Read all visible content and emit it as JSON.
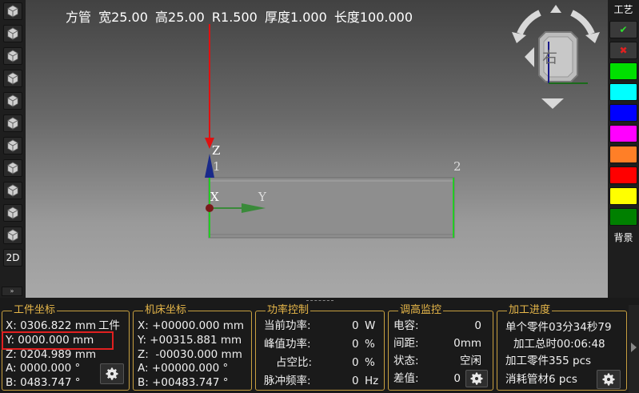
{
  "tube_info": {
    "shape": "方管",
    "width": "宽25.00",
    "height": "高25.00",
    "radius": "R1.500",
    "thickness": "厚度1.000",
    "length": "长度100.000"
  },
  "view_cube": {
    "face_label": "右"
  },
  "axes": {
    "z": "Z",
    "x": "X",
    "y": "Y",
    "point1": "1",
    "point2": "2"
  },
  "left_toolbar": {
    "buttons": [
      "view-iso-1",
      "view-front",
      "view-back",
      "view-left",
      "view-right",
      "view-top",
      "view-bottom",
      "view-iso-2",
      "view-iso-3",
      "view-iso-4",
      "view-iso-5"
    ],
    "label_2d": "2D",
    "collapse": "»"
  },
  "right_bar": {
    "process_label": "工艺",
    "confirm": "✔",
    "cancel": "✖",
    "layer_colors": [
      "#00e000",
      "#00ffff",
      "#0000ff",
      "#ff00ff",
      "#ff7f27",
      "#ff0000",
      "#ffff00",
      "#008000"
    ],
    "background_label": "背景"
  },
  "workpiece": {
    "title": "工件坐标",
    "x": "X: 0306.822 mm",
    "x_tag": "工件",
    "y": "Y: 0000.000 mm",
    "z": "Z: 0204.989 mm",
    "a": "A: 0000.000 °",
    "b": "B: 0483.747 °"
  },
  "machine": {
    "title": "机床坐标",
    "x": "X: +00000.000 mm",
    "y": "Y: +00315.881 mm",
    "z": "Z:  -00030.000 mm",
    "a": "A: +00000.000 °",
    "b": "B: +00483.747 °"
  },
  "power": {
    "title": "功率控制",
    "rows": [
      {
        "label": "当前功率:",
        "value": "0",
        "unit": "W"
      },
      {
        "label": "峰值功率:",
        "value": "0",
        "unit": "%"
      },
      {
        "label": "占空比:",
        "value": "0",
        "unit": "%"
      },
      {
        "label": "脉冲频率:",
        "value": "0",
        "unit": "Hz"
      }
    ]
  },
  "height": {
    "title": "调高监控",
    "rows": [
      {
        "label": "电容:",
        "value": "0"
      },
      {
        "label": "间距:",
        "value": "0mm"
      },
      {
        "label": "状态:",
        "value": "空闲"
      },
      {
        "label": "差值:",
        "value": "0"
      }
    ]
  },
  "progress": {
    "title": "加工进度",
    "single_part": "单个零件03分34秒79",
    "total": "加工总时00:06:48",
    "parts": "加工零件355 pcs",
    "tubes": "消耗管材6 pcs"
  }
}
